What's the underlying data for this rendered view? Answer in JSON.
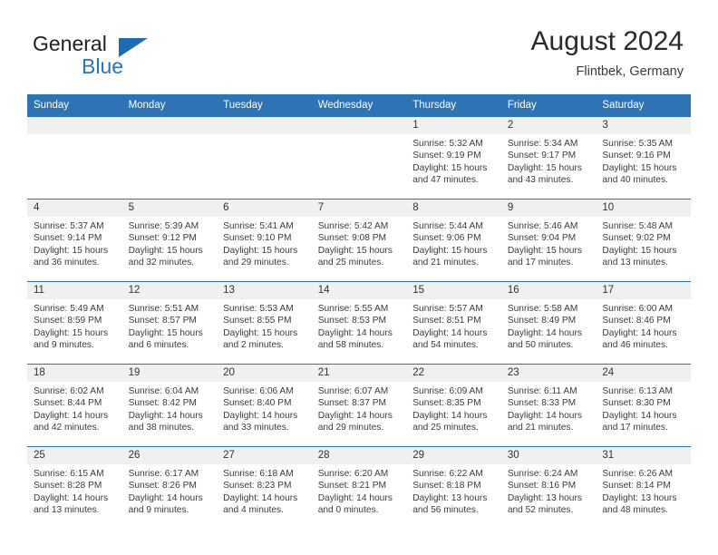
{
  "brand": {
    "line1": "General",
    "line2": "Blue",
    "triangle_color": "#1b6cb5",
    "text_color": "#231f20",
    "accent_color": "#2176bd"
  },
  "header": {
    "title": "August 2024",
    "subtitle": "Flintbek, Germany"
  },
  "theme": {
    "header_bg": "#2e74b5",
    "header_text": "#ffffff",
    "daynum_bg": "#f0f0f0",
    "cell_bg": "#ffffff",
    "border": "#2e74b5"
  },
  "weekdays": [
    "Sunday",
    "Monday",
    "Tuesday",
    "Wednesday",
    "Thursday",
    "Friday",
    "Saturday"
  ],
  "weeks": [
    [
      {
        "day": "",
        "sunrise": "",
        "sunset": "",
        "daylight1": "",
        "daylight2": ""
      },
      {
        "day": "",
        "sunrise": "",
        "sunset": "",
        "daylight1": "",
        "daylight2": ""
      },
      {
        "day": "",
        "sunrise": "",
        "sunset": "",
        "daylight1": "",
        "daylight2": ""
      },
      {
        "day": "",
        "sunrise": "",
        "sunset": "",
        "daylight1": "",
        "daylight2": ""
      },
      {
        "day": "1",
        "sunrise": "Sunrise: 5:32 AM",
        "sunset": "Sunset: 9:19 PM",
        "daylight1": "Daylight: 15 hours",
        "daylight2": "and 47 minutes."
      },
      {
        "day": "2",
        "sunrise": "Sunrise: 5:34 AM",
        "sunset": "Sunset: 9:17 PM",
        "daylight1": "Daylight: 15 hours",
        "daylight2": "and 43 minutes."
      },
      {
        "day": "3",
        "sunrise": "Sunrise: 5:35 AM",
        "sunset": "Sunset: 9:16 PM",
        "daylight1": "Daylight: 15 hours",
        "daylight2": "and 40 minutes."
      }
    ],
    [
      {
        "day": "4",
        "sunrise": "Sunrise: 5:37 AM",
        "sunset": "Sunset: 9:14 PM",
        "daylight1": "Daylight: 15 hours",
        "daylight2": "and 36 minutes."
      },
      {
        "day": "5",
        "sunrise": "Sunrise: 5:39 AM",
        "sunset": "Sunset: 9:12 PM",
        "daylight1": "Daylight: 15 hours",
        "daylight2": "and 32 minutes."
      },
      {
        "day": "6",
        "sunrise": "Sunrise: 5:41 AM",
        "sunset": "Sunset: 9:10 PM",
        "daylight1": "Daylight: 15 hours",
        "daylight2": "and 29 minutes."
      },
      {
        "day": "7",
        "sunrise": "Sunrise: 5:42 AM",
        "sunset": "Sunset: 9:08 PM",
        "daylight1": "Daylight: 15 hours",
        "daylight2": "and 25 minutes."
      },
      {
        "day": "8",
        "sunrise": "Sunrise: 5:44 AM",
        "sunset": "Sunset: 9:06 PM",
        "daylight1": "Daylight: 15 hours",
        "daylight2": "and 21 minutes."
      },
      {
        "day": "9",
        "sunrise": "Sunrise: 5:46 AM",
        "sunset": "Sunset: 9:04 PM",
        "daylight1": "Daylight: 15 hours",
        "daylight2": "and 17 minutes."
      },
      {
        "day": "10",
        "sunrise": "Sunrise: 5:48 AM",
        "sunset": "Sunset: 9:02 PM",
        "daylight1": "Daylight: 15 hours",
        "daylight2": "and 13 minutes."
      }
    ],
    [
      {
        "day": "11",
        "sunrise": "Sunrise: 5:49 AM",
        "sunset": "Sunset: 8:59 PM",
        "daylight1": "Daylight: 15 hours",
        "daylight2": "and 9 minutes."
      },
      {
        "day": "12",
        "sunrise": "Sunrise: 5:51 AM",
        "sunset": "Sunset: 8:57 PM",
        "daylight1": "Daylight: 15 hours",
        "daylight2": "and 6 minutes."
      },
      {
        "day": "13",
        "sunrise": "Sunrise: 5:53 AM",
        "sunset": "Sunset: 8:55 PM",
        "daylight1": "Daylight: 15 hours",
        "daylight2": "and 2 minutes."
      },
      {
        "day": "14",
        "sunrise": "Sunrise: 5:55 AM",
        "sunset": "Sunset: 8:53 PM",
        "daylight1": "Daylight: 14 hours",
        "daylight2": "and 58 minutes."
      },
      {
        "day": "15",
        "sunrise": "Sunrise: 5:57 AM",
        "sunset": "Sunset: 8:51 PM",
        "daylight1": "Daylight: 14 hours",
        "daylight2": "and 54 minutes."
      },
      {
        "day": "16",
        "sunrise": "Sunrise: 5:58 AM",
        "sunset": "Sunset: 8:49 PM",
        "daylight1": "Daylight: 14 hours",
        "daylight2": "and 50 minutes."
      },
      {
        "day": "17",
        "sunrise": "Sunrise: 6:00 AM",
        "sunset": "Sunset: 8:46 PM",
        "daylight1": "Daylight: 14 hours",
        "daylight2": "and 46 minutes."
      }
    ],
    [
      {
        "day": "18",
        "sunrise": "Sunrise: 6:02 AM",
        "sunset": "Sunset: 8:44 PM",
        "daylight1": "Daylight: 14 hours",
        "daylight2": "and 42 minutes."
      },
      {
        "day": "19",
        "sunrise": "Sunrise: 6:04 AM",
        "sunset": "Sunset: 8:42 PM",
        "daylight1": "Daylight: 14 hours",
        "daylight2": "and 38 minutes."
      },
      {
        "day": "20",
        "sunrise": "Sunrise: 6:06 AM",
        "sunset": "Sunset: 8:40 PM",
        "daylight1": "Daylight: 14 hours",
        "daylight2": "and 33 minutes."
      },
      {
        "day": "21",
        "sunrise": "Sunrise: 6:07 AM",
        "sunset": "Sunset: 8:37 PM",
        "daylight1": "Daylight: 14 hours",
        "daylight2": "and 29 minutes."
      },
      {
        "day": "22",
        "sunrise": "Sunrise: 6:09 AM",
        "sunset": "Sunset: 8:35 PM",
        "daylight1": "Daylight: 14 hours",
        "daylight2": "and 25 minutes."
      },
      {
        "day": "23",
        "sunrise": "Sunrise: 6:11 AM",
        "sunset": "Sunset: 8:33 PM",
        "daylight1": "Daylight: 14 hours",
        "daylight2": "and 21 minutes."
      },
      {
        "day": "24",
        "sunrise": "Sunrise: 6:13 AM",
        "sunset": "Sunset: 8:30 PM",
        "daylight1": "Daylight: 14 hours",
        "daylight2": "and 17 minutes."
      }
    ],
    [
      {
        "day": "25",
        "sunrise": "Sunrise: 6:15 AM",
        "sunset": "Sunset: 8:28 PM",
        "daylight1": "Daylight: 14 hours",
        "daylight2": "and 13 minutes."
      },
      {
        "day": "26",
        "sunrise": "Sunrise: 6:17 AM",
        "sunset": "Sunset: 8:26 PM",
        "daylight1": "Daylight: 14 hours",
        "daylight2": "and 9 minutes."
      },
      {
        "day": "27",
        "sunrise": "Sunrise: 6:18 AM",
        "sunset": "Sunset: 8:23 PM",
        "daylight1": "Daylight: 14 hours",
        "daylight2": "and 4 minutes."
      },
      {
        "day": "28",
        "sunrise": "Sunrise: 6:20 AM",
        "sunset": "Sunset: 8:21 PM",
        "daylight1": "Daylight: 14 hours",
        "daylight2": "and 0 minutes."
      },
      {
        "day": "29",
        "sunrise": "Sunrise: 6:22 AM",
        "sunset": "Sunset: 8:18 PM",
        "daylight1": "Daylight: 13 hours",
        "daylight2": "and 56 minutes."
      },
      {
        "day": "30",
        "sunrise": "Sunrise: 6:24 AM",
        "sunset": "Sunset: 8:16 PM",
        "daylight1": "Daylight: 13 hours",
        "daylight2": "and 52 minutes."
      },
      {
        "day": "31",
        "sunrise": "Sunrise: 6:26 AM",
        "sunset": "Sunset: 8:14 PM",
        "daylight1": "Daylight: 13 hours",
        "daylight2": "and 48 minutes."
      }
    ]
  ]
}
